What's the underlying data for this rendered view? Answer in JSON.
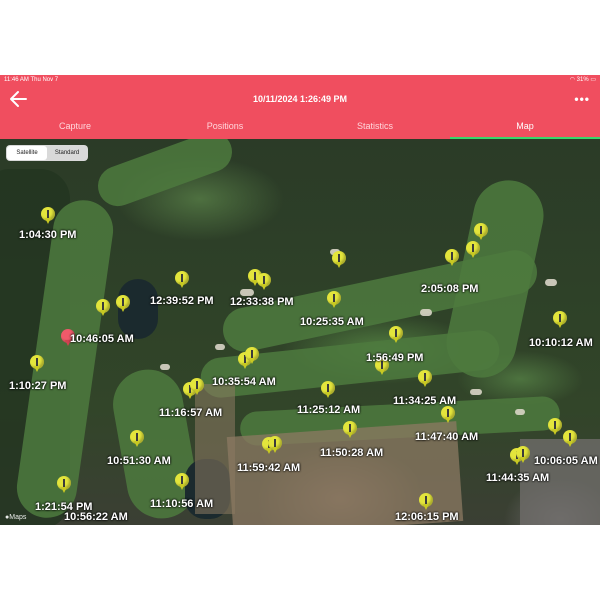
{
  "status_bar": {
    "time": "11:46 AM  Thu Nov 7",
    "battery": "31%"
  },
  "header": {
    "title": "10/11/2024 1:26:49 PM",
    "more_label": "•••"
  },
  "tabs": [
    {
      "label": "Capture"
    },
    {
      "label": "Positions"
    },
    {
      "label": "Statistics"
    },
    {
      "label": "Map"
    }
  ],
  "map": {
    "toggle": {
      "satellite": "Satellite",
      "standard": "Standard"
    },
    "legal": "Maps",
    "timestamps": [
      {
        "label": "1:04:30 PM"
      },
      {
        "label": "12:39:52 PM"
      },
      {
        "label": "12:33:38 PM"
      },
      {
        "label": "10:25:35 AM"
      },
      {
        "label": "2:05:08 PM"
      },
      {
        "label": "10:46:05 AM"
      },
      {
        "label": "10:10:12 AM"
      },
      {
        "label": "1:56:49 PM"
      },
      {
        "label": "1:10:27 PM"
      },
      {
        "label": "10:35:54 AM"
      },
      {
        "label": "11:34:25 AM"
      },
      {
        "label": "11:16:57 AM"
      },
      {
        "label": "11:25:12 AM"
      },
      {
        "label": "11:47:40 AM"
      },
      {
        "label": "10:51:30 AM"
      },
      {
        "label": "11:50:28 AM"
      },
      {
        "label": "10:06:05 AM"
      },
      {
        "label": "11:59:42 AM"
      },
      {
        "label": "11:44:35 AM"
      },
      {
        "label": "1:21:54 PM"
      },
      {
        "label": "11:10:56 AM"
      },
      {
        "label": "12:06:15 PM"
      },
      {
        "label": "10:56:22 AM"
      }
    ]
  },
  "colors": {
    "accent": "#f04e5f",
    "active_tab_underline": "#39d66b",
    "pin": "#e3e53c",
    "selected_pin": "#ef5a6a"
  }
}
